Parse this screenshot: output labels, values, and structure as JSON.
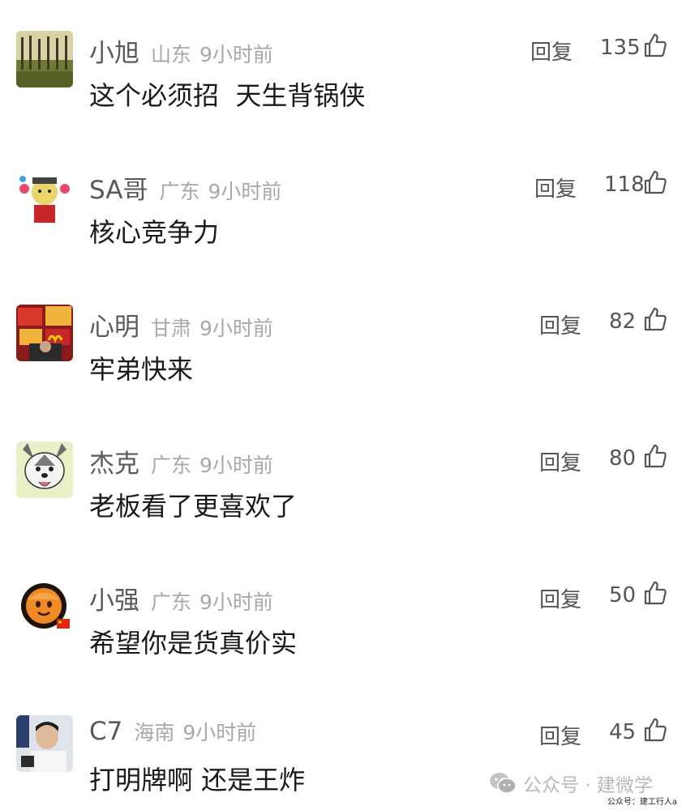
{
  "comments": [
    {
      "username": "小旭",
      "location": "山东",
      "time": "9小时前",
      "text": "这个必须招  天生背锅侠",
      "reply_label": "回复",
      "likes": "135",
      "avatar": "tree-landscape-avatar"
    },
    {
      "username": "SA哥",
      "location": "广东",
      "time": "9小时前",
      "text": "核心竞争力",
      "reply_label": "回复",
      "likes": "118",
      "avatar": "cartoon-character-avatar"
    },
    {
      "username": "心明",
      "location": "甘肃",
      "time": "9小时前",
      "text": "牢弟快来",
      "reply_label": "回复",
      "likes": "82",
      "avatar": "burger-king-mcdonalds-avatar"
    },
    {
      "username": "杰克",
      "location": "广东",
      "time": "9小时前",
      "text": "老板看了更喜欢了",
      "reply_label": "回复",
      "likes": "80",
      "avatar": "husky-dog-cartoon-avatar"
    },
    {
      "username": "小强",
      "location": "广东",
      "time": "9小时前",
      "text": "希望你是货真价实",
      "reply_label": "回复",
      "likes": "50",
      "avatar": "orange-cartoon-face-avatar"
    },
    {
      "username": "C7",
      "location": "海南",
      "time": "9小时前",
      "text": "打明牌啊 还是王炸",
      "reply_label": "回复",
      "likes": "45",
      "avatar": "man-portrait-avatar"
    }
  ],
  "watermark": {
    "text": "公众号 · 建微学",
    "icon": "wechat-icon"
  },
  "credit": {
    "text": "公众号：建工行人a"
  },
  "colors": {
    "username": "#5a5a5a",
    "meta": "#a8a8a8",
    "text": "#1a1a1a",
    "action": "#555555"
  }
}
